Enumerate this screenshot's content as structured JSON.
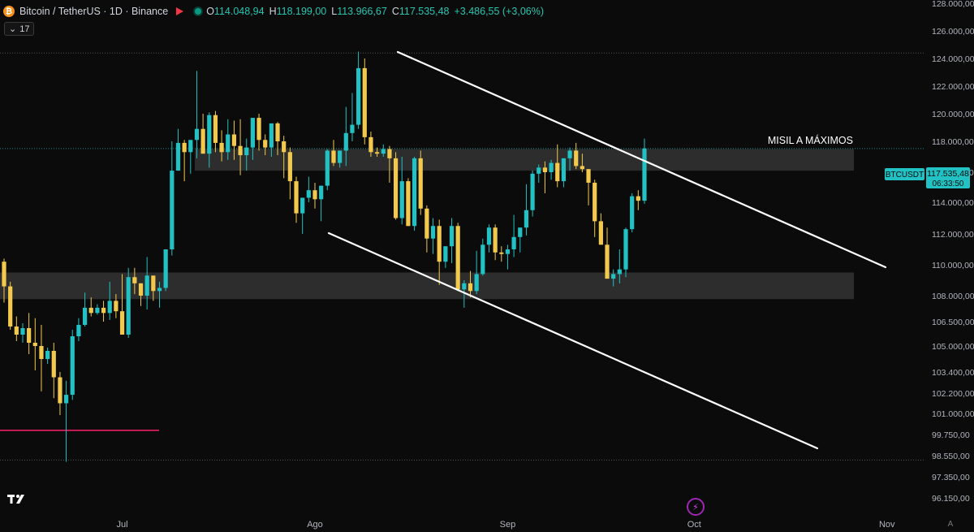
{
  "header": {
    "symbol_title": "Bitcoin / TetherUS · 1D · Binance",
    "ohlc": {
      "open_label": "O",
      "open": "114.048,94",
      "high_label": "H",
      "high": "118.199,00",
      "low_label": "L",
      "low": "113.966,67",
      "close_label": "C",
      "close": "117.535,48",
      "change": "+3.486,55 (+3,06%)"
    },
    "indicator_count": "17"
  },
  "price_tag": {
    "symbol": "BTCUSDT",
    "price": "117.535,48",
    "countdown": "06:33:50"
  },
  "colors": {
    "background": "#0b0b0b",
    "up": "#22c1c3",
    "down": "#f2c94c",
    "zone": "#3a3a3a",
    "channel": "#ffffff",
    "support_line": "#e91e63",
    "price_tag": "#22c1c3"
  },
  "chart_data": {
    "type": "candlestick",
    "annotation": "MISIL A MÁXIMOS",
    "y_ticks": [
      "128.000,00",
      "126.000,00",
      "124.000,00",
      "122.000,00",
      "120.000,00",
      "118.000,00",
      "116.000,00",
      "114.000,00",
      "112.000,00",
      "110.000,00",
      "108.000,00",
      "106.500,00",
      "105.000,00",
      "103.400,00",
      "102.200,00",
      "101.000,00",
      "99.750,00",
      "98.550,00",
      "97.350,00",
      "96.150,00"
    ],
    "x_ticks": [
      "Jul",
      "Ago",
      "Sep",
      "Oct",
      "Nov"
    ],
    "x_tick_dates": [
      "2025-07-01",
      "2025-08-01",
      "2025-09-01",
      "2025-10-01",
      "2025-11-01"
    ],
    "dates_start": "2025-06-12",
    "candles": [
      [
        110200,
        110400,
        107600,
        108600
      ],
      [
        108600,
        108900,
        106000,
        106200
      ],
      [
        106200,
        106800,
        105300,
        105700
      ],
      [
        105700,
        106400,
        105200,
        106100
      ],
      [
        106100,
        107000,
        104500,
        105200
      ],
      [
        105200,
        106700,
        103500,
        105000
      ],
      [
        105000,
        106300,
        102300,
        104200
      ],
      [
        104200,
        104900,
        103900,
        104700
      ],
      [
        104700,
        105200,
        101900,
        103100
      ],
      [
        103100,
        103400,
        100900,
        101600
      ],
      [
        101600,
        102900,
        98200,
        102100
      ],
      [
        102100,
        106000,
        101800,
        105600
      ],
      [
        105600,
        106700,
        105300,
        106300
      ],
      [
        106300,
        108200,
        106200,
        107300
      ],
      [
        107300,
        107900,
        106800,
        107000
      ],
      [
        107000,
        107500,
        106900,
        107300
      ],
      [
        107300,
        107700,
        106500,
        107000
      ],
      [
        107000,
        108900,
        106600,
        107700
      ],
      [
        107700,
        108100,
        106700,
        107100
      ],
      [
        107100,
        109400,
        106600,
        105700
      ],
      [
        105700,
        109800,
        105500,
        109200
      ],
      [
        109200,
        109800,
        108100,
        108800
      ],
      [
        108800,
        108600,
        107400,
        108000
      ],
      [
        108000,
        110500,
        107200,
        109300
      ],
      [
        109300,
        108600,
        107700,
        108300
      ],
      [
        108300,
        108900,
        107300,
        108500
      ],
      [
        108500,
        111000,
        108300,
        111000
      ],
      [
        111000,
        118000,
        110600,
        116100
      ],
      [
        116100,
        118900,
        116100,
        117900
      ],
      [
        117900,
        118100,
        115400,
        117300
      ],
      [
        117300,
        118000,
        115900,
        118100
      ],
      [
        118100,
        123100,
        116900,
        118900
      ],
      [
        118900,
        120000,
        117900,
        117200
      ],
      [
        117200,
        120100,
        116300,
        119900
      ],
      [
        119900,
        120200,
        117300,
        117900
      ],
      [
        117900,
        118800,
        116700,
        117300
      ],
      [
        117300,
        119600,
        116800,
        118500
      ],
      [
        118500,
        119500,
        116800,
        117700
      ],
      [
        117700,
        119600,
        115800,
        117100
      ],
      [
        117100,
        118200,
        116100,
        117600
      ],
      [
        117600,
        119200,
        116800,
        119700
      ],
      [
        119700,
        120000,
        117400,
        118100
      ],
      [
        118100,
        118500,
        117100,
        117600
      ],
      [
        117600,
        119300,
        117000,
        119300
      ],
      [
        119300,
        119400,
        117100,
        118000
      ],
      [
        118000,
        118400,
        115600,
        117300
      ],
      [
        117300,
        117600,
        114200,
        115400
      ],
      [
        115400,
        115700,
        112700,
        113300
      ],
      [
        113300,
        113700,
        112000,
        114300
      ],
      [
        114300,
        115700,
        114000,
        114800
      ],
      [
        114800,
        115300,
        113600,
        114200
      ],
      [
        114200,
        114800,
        112800,
        115100
      ],
      [
        115100,
        117500,
        114800,
        117400
      ],
      [
        117400,
        118100,
        116400,
        116600
      ],
      [
        116600,
        117300,
        116300,
        117400
      ],
      [
        117400,
        120500,
        116400,
        118600
      ],
      [
        118600,
        121500,
        118000,
        119200
      ],
      [
        119200,
        124500,
        118900,
        123300
      ],
      [
        123300,
        124000,
        117800,
        118300
      ],
      [
        118300,
        118700,
        117000,
        117300
      ],
      [
        117300,
        117600,
        117000,
        117200
      ],
      [
        117200,
        117800,
        117000,
        117500
      ],
      [
        117500,
        117700,
        115300,
        116900
      ],
      [
        116900,
        117300,
        112900,
        113000
      ],
      [
        113000,
        117000,
        112600,
        115400
      ],
      [
        115400,
        115600,
        112900,
        112500
      ],
      [
        112500,
        117000,
        112200,
        116900
      ],
      [
        116900,
        117400,
        113200,
        113600
      ],
      [
        113600,
        113800,
        110800,
        111700
      ],
      [
        111700,
        113000,
        110700,
        112500
      ],
      [
        112500,
        112900,
        108700,
        110200
      ],
      [
        110200,
        111200,
        109800,
        111200
      ],
      [
        111200,
        113000,
        110100,
        112500
      ],
      [
        112500,
        112700,
        108300,
        108400
      ],
      [
        108400,
        109000,
        107300,
        108800
      ],
      [
        108800,
        109600,
        107900,
        108300
      ],
      [
        108300,
        110900,
        108100,
        109400
      ],
      [
        109400,
        111700,
        109300,
        111300
      ],
      [
        111300,
        112600,
        110800,
        112400
      ],
      [
        112400,
        112600,
        110300,
        110800
      ],
      [
        110800,
        111200,
        110200,
        110700
      ],
      [
        110700,
        111300,
        109700,
        111000
      ],
      [
        111000,
        113200,
        110500,
        111800
      ],
      [
        111800,
        112400,
        110800,
        112400
      ],
      [
        112400,
        115200,
        111900,
        113500
      ],
      [
        113500,
        116100,
        113100,
        115900
      ],
      [
        115900,
        116500,
        115300,
        116300
      ],
      [
        116300,
        116700,
        114600,
        116000
      ],
      [
        116000,
        116800,
        115500,
        116600
      ],
      [
        116600,
        117800,
        115000,
        115400
      ],
      [
        115400,
        116900,
        115000,
        116900
      ],
      [
        116900,
        117600,
        116100,
        117400
      ],
      [
        117400,
        117900,
        116200,
        116400
      ],
      [
        116400,
        117200,
        116000,
        116200
      ],
      [
        116200,
        115400,
        113800,
        115300
      ],
      [
        115300,
        115500,
        111800,
        112800
      ],
      [
        112800,
        113300,
        111700,
        111300
      ],
      [
        111300,
        112400,
        111100,
        109100
      ],
      [
        109100,
        109700,
        108600,
        109400
      ],
      [
        109400,
        111000,
        108800,
        109700
      ],
      [
        109700,
        112400,
        109200,
        112300
      ],
      [
        112300,
        114600,
        112100,
        114400
      ],
      [
        114400,
        114800,
        113500,
        114100
      ],
      [
        114100,
        118200,
        113900,
        117535
      ]
    ]
  }
}
